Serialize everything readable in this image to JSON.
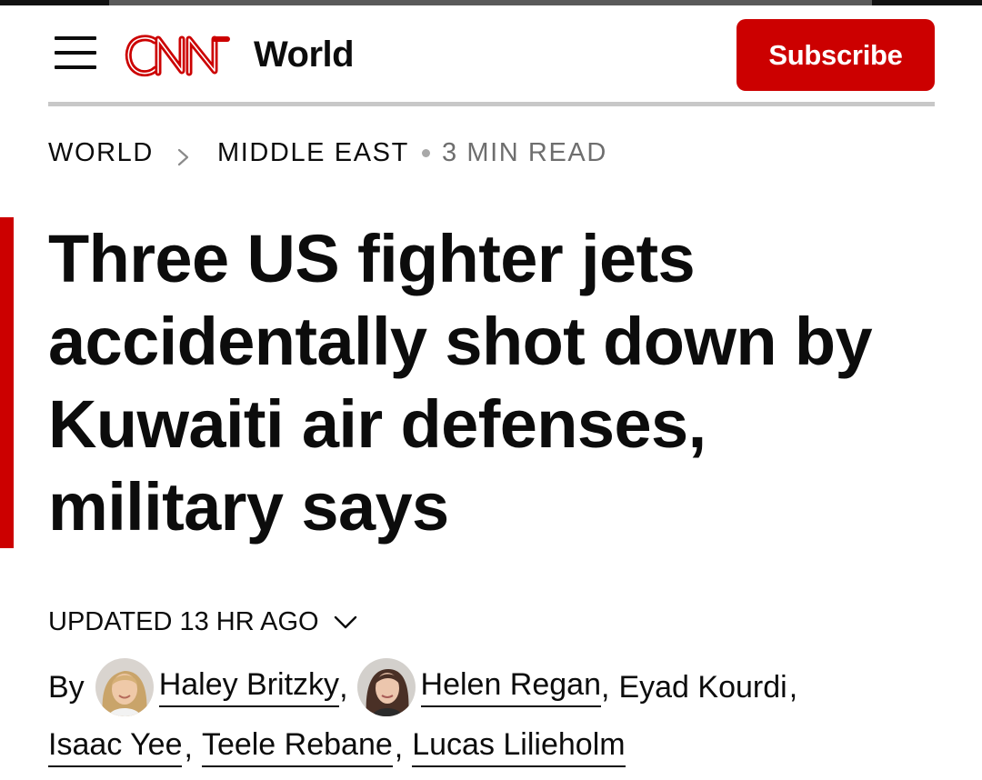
{
  "header": {
    "brand_logo": "CNN",
    "section": "World",
    "subscribe_label": "Subscribe"
  },
  "breadcrumb": {
    "items": [
      "WORLD",
      "MIDDLE EAST"
    ],
    "read_time": "3 MIN READ"
  },
  "article": {
    "headline_lines": [
      "Three US fighter jets",
      "accidentally shot down by",
      "Kuwaiti air defenses,",
      "military says"
    ],
    "updated": "UPDATED 13 HR AGO",
    "by_label": "By",
    "authors": [
      {
        "name": "Haley Britzky",
        "linked": true,
        "has_avatar": true
      },
      {
        "name": "Helen Regan",
        "linked": true,
        "has_avatar": true
      },
      {
        "name": "Eyad Kourdi",
        "linked": false,
        "has_avatar": false
      },
      {
        "name": "Isaac Yee",
        "linked": true,
        "has_avatar": false
      },
      {
        "name": "Teele Rebane",
        "linked": true,
        "has_avatar": false
      },
      {
        "name": "Lucas Lilieholm",
        "linked": true,
        "has_avatar": false
      }
    ]
  },
  "reading_progress": 0.78,
  "colors": {
    "brand_red": "#cc0000",
    "text": "#0c0c0c",
    "muted": "#6e6e6e",
    "rule": "#c8c8c8"
  },
  "icons": {
    "menu": "hamburger-icon",
    "breadcrumb_separator": "chevron-right-icon",
    "updated_toggle": "chevron-down-icon"
  }
}
